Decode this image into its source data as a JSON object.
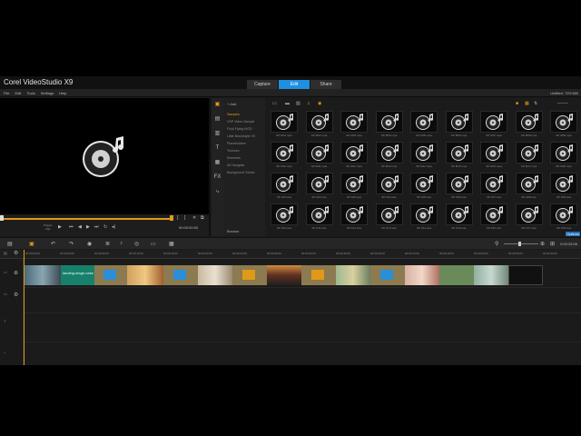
{
  "app": {
    "title": "Corel VideoStudio X9",
    "project_name": "Untitled, 720*480"
  },
  "tabs": [
    {
      "label": "Capture"
    },
    {
      "label": "Edit",
      "active": true
    },
    {
      "label": "Share"
    }
  ],
  "menu": [
    "File",
    "Edit",
    "Tools",
    "Settings",
    "Help"
  ],
  "preview": {
    "icon": "media-disc-music-icon",
    "mode_label_1": "Project",
    "mode_label_2": "Clip",
    "timecode": "00:00:00:00"
  },
  "library": {
    "add_label": "Add",
    "browse_label": "Browse",
    "options_label": "Options",
    "folders": [
      "Samples",
      "VSP Video Sample",
      "Fluid Flying MOD",
      "Little Brookstyle VS",
      "Placeholders",
      "Textures",
      "Elements",
      "All Hangelia",
      "Background Series"
    ],
    "thumbs": [
      "SP-M01.mpa",
      "SP-M02.mpa",
      "SP-M03.mpa",
      "SP-M04.mpa",
      "SP-M05.mpa",
      "SP-M06.mpa",
      "SP-M07.mpa",
      "SP-M08.mpa",
      "SP-M09.mpa",
      "SP-M10.mpa",
      "SP-M11.mpa",
      "SP-M12.mpa",
      "SP-M13.mpa",
      "SP-M14.mpa",
      "SP-M15.mpa",
      "SP-M16.mpa",
      "SP-M17.mpa",
      "SP-M18.mpa",
      "SP-S01.wav",
      "SP-S02.wav",
      "SP-S03.wav",
      "SP-S04.wav",
      "SP-S05.wav",
      "SP-S06.wav",
      "SP-S07.wav",
      "SP-S08.wav",
      "SP-S09.wav",
      "SP-S10.wav",
      "SP-S11.wav",
      "SP-S12.wav",
      "SP-S13.wav",
      "SP-S14.wav",
      "SP-S15.wav",
      "SP-S16.wav",
      "SP-S17.wav",
      "SP-S18.wav"
    ]
  },
  "ruler": [
    "00:00:00:00",
    "00:00:04:00",
    "00:00:08:00",
    "00:00:12:00",
    "00:00:16:00",
    "00:00:20:00",
    "00:00:24:00",
    "00:00:28:00",
    "00:00:32:00",
    "00:00:36:00",
    "00:00:40:00",
    "00:00:44:00",
    "00:00:48:00",
    "00:00:52:00",
    "00:00:56:00",
    "00:01:00:00"
  ],
  "timeline": {
    "duration": "0:00:25:06",
    "video_track_label": "landing-stage-vase",
    "colors": {
      "accent": "#e09a18",
      "tab_active": "#1f8fe0",
      "teal_clip": "#18806a",
      "transition": "#2a8fd8"
    }
  }
}
